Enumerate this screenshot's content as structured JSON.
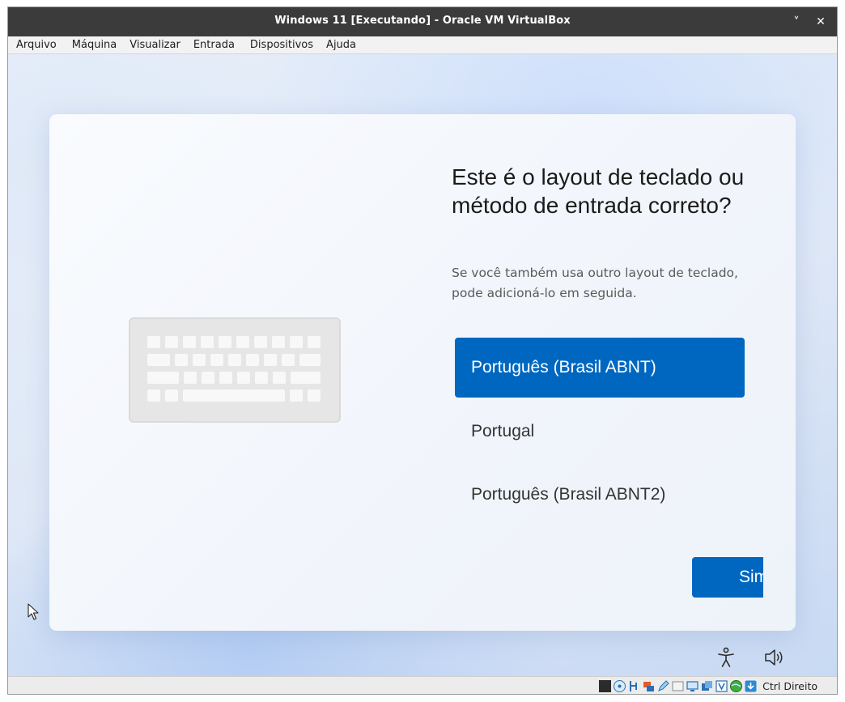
{
  "window": {
    "title": "Windows 11 [Executando] - Oracle VM VirtualBox",
    "minimize_glyph": "˅",
    "close_glyph": "✕"
  },
  "menu": {
    "items": [
      {
        "label": "Arquivo"
      },
      {
        "label": "Máquina"
      },
      {
        "label": "Visualizar"
      },
      {
        "label": "Entrada"
      },
      {
        "label": "Dispositivos"
      },
      {
        "label": "Ajuda"
      }
    ]
  },
  "oobe": {
    "heading": "Este é o layout de teclado ou método de entrada correto?",
    "subtext": "Se você também usa outro layout de teclado, pode adicioná-lo em seguida.",
    "options": [
      {
        "label": "Português (Brasil ABNT)",
        "selected": true
      },
      {
        "label": "Portugal",
        "selected": false
      },
      {
        "label": "Português (Brasil ABNT2)",
        "selected": false
      }
    ],
    "confirm_button": "Sim",
    "accent_color": "#0067c0",
    "illustration": "keyboard-illustration",
    "bottom_icons": [
      "accessibility-icon",
      "volume-icon"
    ]
  },
  "statusbar": {
    "icons": [
      "display-icon",
      "optical-drive-icon",
      "usb-icon",
      "network-icon",
      "pencil-icon",
      "shared-folder-icon",
      "screen-icon",
      "vm-window-icon",
      "virtualization-icon",
      "globe-icon",
      "download-icon"
    ],
    "host_key": "Ctrl Direito"
  }
}
